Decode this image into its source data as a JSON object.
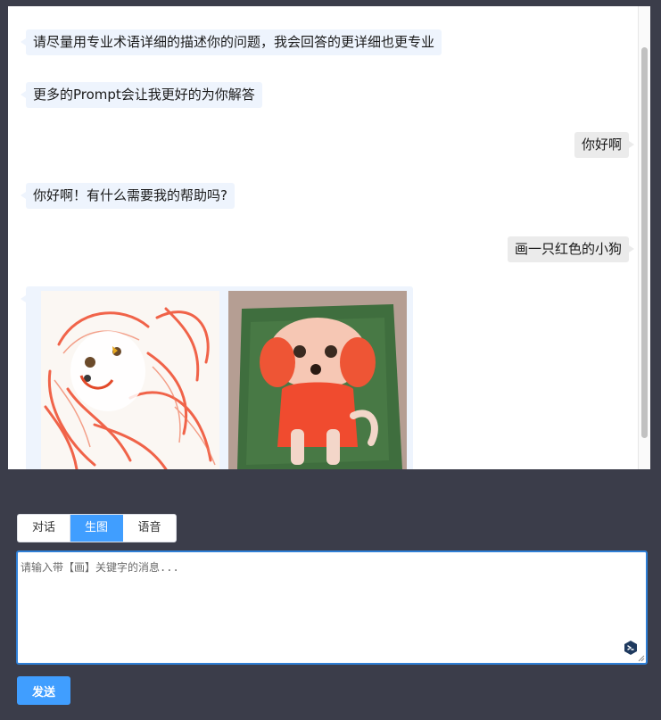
{
  "messages": [
    {
      "role": "bot",
      "text": "请尽量用专业术语详细的描述你的问题，我会回答的更详细也更专业"
    },
    {
      "role": "bot",
      "text": "更多的Prompt会让我更好的为你解答"
    },
    {
      "role": "user",
      "text": "你好啊"
    },
    {
      "role": "bot",
      "text": "你好啊！有什么需要我的帮助吗?"
    },
    {
      "role": "user",
      "text": "画一只红色的小狗"
    }
  ],
  "modes": [
    {
      "label": "对话",
      "active": false
    },
    {
      "label": "生图",
      "active": true
    },
    {
      "label": "语音",
      "active": false
    }
  ],
  "input": {
    "placeholder": "请输入带【画】关键字的消息...",
    "value": ""
  },
  "send_label": "发送",
  "colors": {
    "accent": "#409eff",
    "background": "#3b3d4a",
    "bot_bubble": "#eef4fd",
    "user_bubble": "#ebebeb"
  }
}
